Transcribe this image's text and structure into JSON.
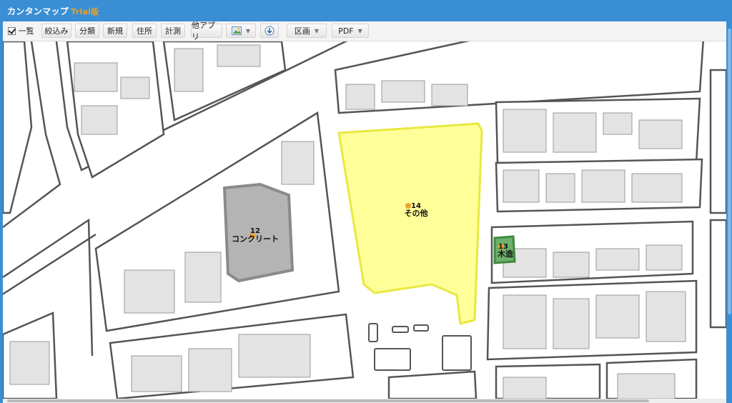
{
  "app": {
    "title": "カンタンマップ",
    "edition": "Trial版"
  },
  "toolbar": {
    "list_label": "一覧",
    "filter_label": "絞込み",
    "classify_label": "分類",
    "new_label": "新規",
    "address_label": "住所",
    "measure_label": "計測",
    "other_apps_label": "他アプリ",
    "zone_label": "区画",
    "pdf_label": "PDF"
  },
  "parcels": [
    {
      "number": "14",
      "type": "その他",
      "fill": "#ffff99",
      "stroke": "#e8e840"
    },
    {
      "number": "12",
      "type": "コンクリート",
      "fill": "#b4b4b4",
      "stroke": "#8a8a8a"
    },
    {
      "number": "13",
      "type": "木造",
      "fill": "#6cb06c",
      "stroke": "#3e8a3e"
    }
  ],
  "colors": {
    "accent": "#3a8fd4",
    "trial": "#f0a020",
    "marker": "#f0a030"
  }
}
